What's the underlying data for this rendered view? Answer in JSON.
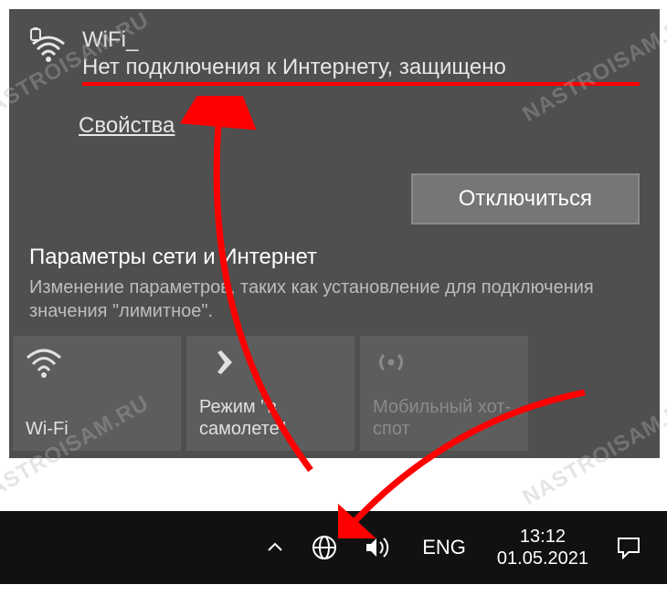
{
  "network": {
    "ssid": "WiFi_",
    "status": "Нет подключения к Интернету, защищено",
    "properties_label": "Свойства",
    "disconnect_label": "Отключиться"
  },
  "settings": {
    "title": "Параметры сети и Интернет",
    "description": "Изменение параметров, таких как установление для подключения значения \"лимитное\"."
  },
  "tiles": {
    "wifi": "Wi-Fi",
    "airplane": "Режим \"в самолете\"",
    "hotspot": "Мобильный хот-спот"
  },
  "tray": {
    "lang": "ENG",
    "time": "13:12",
    "date": "01.05.2021"
  },
  "watermark": "NASTROISAM.RU"
}
